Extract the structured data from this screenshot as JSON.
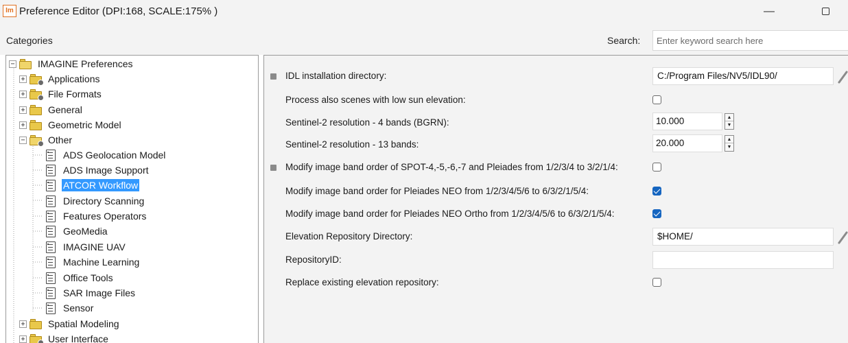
{
  "window": {
    "app_icon_text": "Im",
    "title": "Preference Editor (DPI:168, SCALE:175% )",
    "minimize_glyph": "—"
  },
  "header": {
    "categories_label": "Categories",
    "search_label": "Search:",
    "search_placeholder": "Enter keyword search here",
    "search_value": ""
  },
  "tree": {
    "root": {
      "label": "IMAGINE Preferences",
      "expander": "⊟"
    },
    "top_items": [
      {
        "label": "Applications",
        "expander": "+"
      },
      {
        "label": "File Formats",
        "expander": "+"
      },
      {
        "label": "General",
        "expander": "+"
      },
      {
        "label": "Geometric Model",
        "expander": "+"
      },
      {
        "label": "Other",
        "expander": "−"
      }
    ],
    "other_children": [
      {
        "label": "ADS Geolocation Model",
        "selected": false
      },
      {
        "label": "ADS Image Support",
        "selected": false
      },
      {
        "label": "ATCOR Workflow",
        "selected": true
      },
      {
        "label": "Directory Scanning",
        "selected": false
      },
      {
        "label": "Features Operators",
        "selected": false
      },
      {
        "label": "GeoMedia",
        "selected": false
      },
      {
        "label": "IMAGINE UAV",
        "selected": false
      },
      {
        "label": "Machine Learning",
        "selected": false
      },
      {
        "label": "Office Tools",
        "selected": false
      },
      {
        "label": "SAR Image Files",
        "selected": false
      },
      {
        "label": "Sensor",
        "selected": false
      }
    ],
    "bottom_items": [
      {
        "label": "Spatial Modeling",
        "expander": "+"
      },
      {
        "label": "User Interface",
        "expander": "+"
      }
    ]
  },
  "preferences": [
    {
      "label": "IDL installation directory:",
      "type": "text",
      "value": "C:/Program Files/NV5/IDL90/",
      "bullet": true,
      "editable": true
    },
    {
      "label": "Process also scenes with low sun elevation:",
      "type": "checkbox",
      "checked": false,
      "bullet": false
    },
    {
      "label": "Sentinel-2 resolution - 4 bands (BGRN):",
      "type": "spin",
      "value": "10.000",
      "bullet": false
    },
    {
      "label": "Sentinel-2 resolution - 13 bands:",
      "type": "spin",
      "value": "20.000",
      "bullet": false
    },
    {
      "label": "Modify image band order of SPOT-4,-5,-6,-7 and Pleiades from 1/2/3/4 to 3/2/1/4:",
      "type": "checkbox",
      "checked": false,
      "bullet": true
    },
    {
      "label": "Modify image band order for Pleiades NEO from 1/2/3/4/5/6 to 6/3/2/1/5/4:",
      "type": "checkbox",
      "checked": true,
      "bullet": false
    },
    {
      "label": "Modify image band order for Pleiades NEO Ortho from 1/2/3/4/5/6 to 6/3/2/1/5/4:",
      "type": "checkbox",
      "checked": true,
      "bullet": false
    },
    {
      "label": "Elevation Repository Directory:",
      "type": "text",
      "value": "$HOME/",
      "bullet": false,
      "editable": true
    },
    {
      "label": "RepositoryID:",
      "type": "text",
      "value": "",
      "bullet": false,
      "editable": false
    },
    {
      "label": "Replace existing elevation repository:",
      "type": "checkbox",
      "checked": false,
      "bullet": false
    }
  ],
  "colors": {
    "selection": "#3399ff",
    "checkbox_checked": "#1565c0",
    "panel_background": "#f3f3f3"
  }
}
